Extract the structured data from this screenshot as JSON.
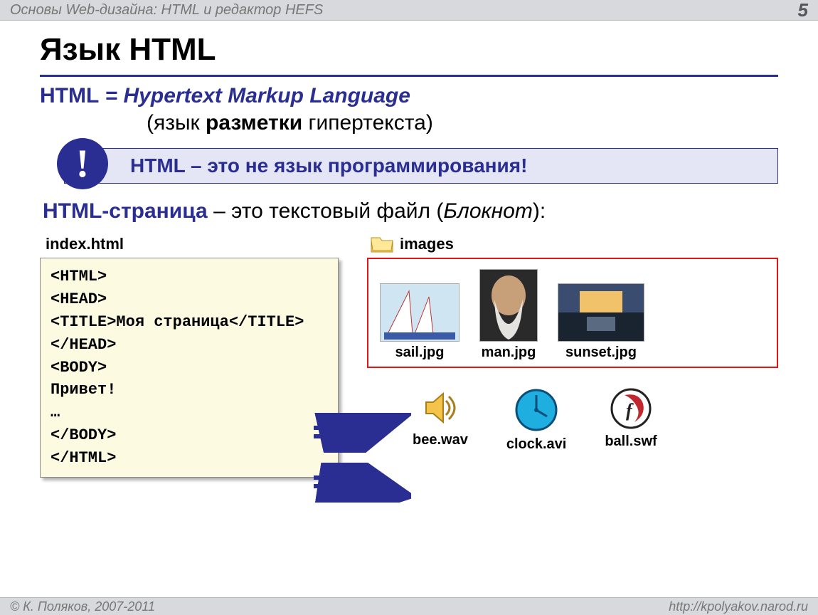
{
  "header": {
    "title": "Основы Web-дизайна: HTML и редактор HEFS",
    "page": "5"
  },
  "slide_title": "Язык HTML",
  "definition": {
    "line1_prefix": "HTML",
    "line1_eq": " = ",
    "line1_term": "Hypertext Markup Language",
    "line2_open": "(язык ",
    "line2_bold": "разметки",
    "line2_rest": " гипертекста)"
  },
  "callout": {
    "bang": "!",
    "text": "HTML – это не язык программирования!"
  },
  "page_line": {
    "kw": "HTML-страница",
    "rest": " – это текстовый файл (",
    "it": "Блокнот",
    "close": "):"
  },
  "code": {
    "filename": "index.html",
    "body": "<HTML>\n<HEAD>\n<TITLE>Моя страница</TITLE>\n</HEAD>\n<BODY>\nПривет!\n…\n</BODY>\n</HTML>"
  },
  "folder": "images",
  "images": [
    {
      "name": "sail.jpg"
    },
    {
      "name": "man.jpg"
    },
    {
      "name": "sunset.jpg"
    }
  ],
  "media": [
    {
      "name": "bee.wav"
    },
    {
      "name": "clock.avi"
    },
    {
      "name": "ball.swf"
    }
  ],
  "footer": {
    "left": "© К. Поляков, 2007-2011",
    "right": "http://kpolyakov.narod.ru"
  }
}
